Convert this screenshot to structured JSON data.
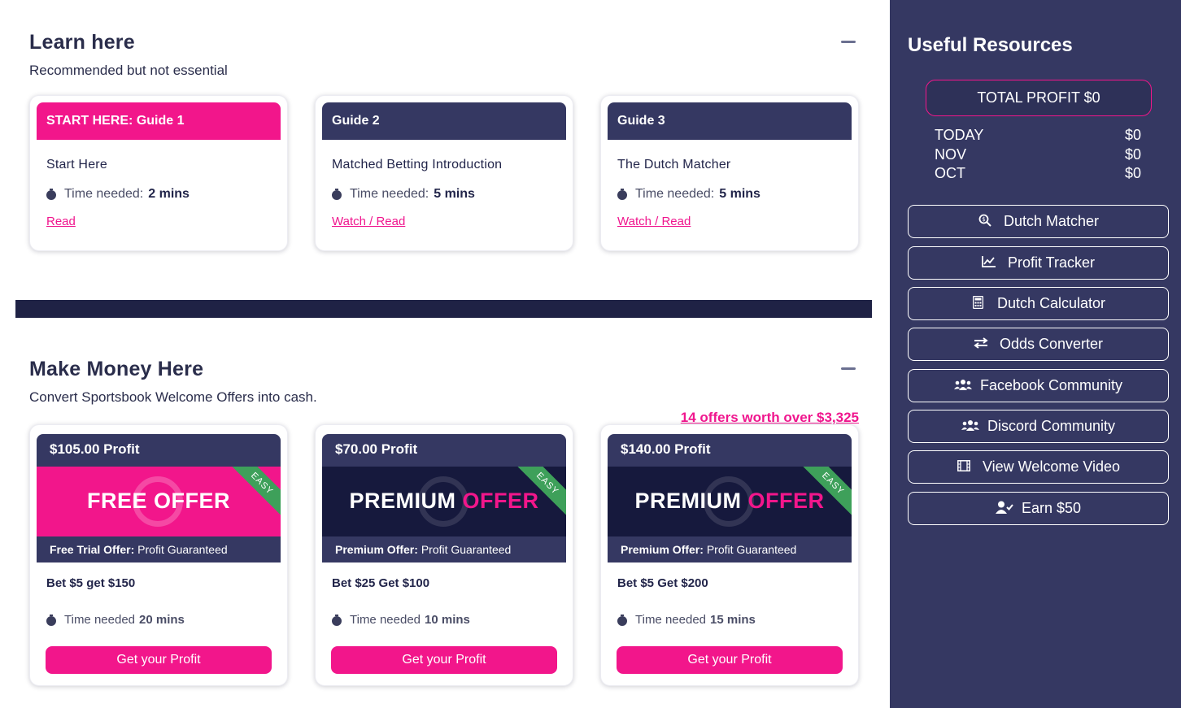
{
  "learn": {
    "title": "Learn here",
    "subtitle": "Recommended but not essential",
    "guides": [
      {
        "header": "START HERE: Guide 1",
        "title": "Start Here",
        "time_label": "Time needed:",
        "time": "2 mins",
        "link": "Read"
      },
      {
        "header": "Guide 2",
        "title": "Matched Betting Introduction",
        "time_label": "Time needed:",
        "time": "5 mins",
        "link": "Watch / Read"
      },
      {
        "header": "Guide 3",
        "title": "The Dutch Matcher",
        "time_label": "Time needed:",
        "time": "5 mins",
        "link": "Watch / Read"
      }
    ]
  },
  "money": {
    "title": "Make Money Here",
    "subtitle": "Convert Sportsbook Welcome Offers into cash.",
    "offers_link": "14 offers worth over $3,325",
    "offers": [
      {
        "profit": "$105.00 Profit",
        "banner_main": "FREE OFFER",
        "banner_accent": "",
        "ribbon": "EASY",
        "foot_bold": "Free Trial Offer:",
        "foot_text": "Profit Guaranteed",
        "bet": "Bet $5 get $150",
        "time_label": "Time needed",
        "time": "20 mins",
        "button": "Get your Profit"
      },
      {
        "profit": "$70.00 Profit",
        "banner_main": "PREMIUM ",
        "banner_accent": "OFFER",
        "ribbon": "EASY",
        "foot_bold": "Premium Offer:",
        "foot_text": "Profit Guaranteed",
        "bet": "Bet $25 Get $100",
        "time_label": "Time needed",
        "time": "10 mins",
        "button": "Get your Profit"
      },
      {
        "profit": "$140.00 Profit",
        "banner_main": "PREMIUM ",
        "banner_accent": "OFFER",
        "ribbon": "EASY",
        "foot_bold": "Premium Offer:",
        "foot_text": "Profit Guaranteed",
        "bet": "Bet $5 Get $200",
        "time_label": "Time needed",
        "time": "15 mins",
        "button": "Get your Profit"
      }
    ]
  },
  "sidebar": {
    "title": "Useful Resources",
    "total_profit": "TOTAL PROFIT $0",
    "rows": [
      {
        "label": "TODAY",
        "value": "$0"
      },
      {
        "label": "NOV",
        "value": "$0"
      },
      {
        "label": "OCT",
        "value": "$0"
      }
    ],
    "buttons": [
      {
        "label": "Dutch Matcher",
        "icon": "search-dollar-icon"
      },
      {
        "label": "Profit Tracker",
        "icon": "chart-line-icon"
      },
      {
        "label": "Dutch Calculator",
        "icon": "calculator-icon"
      },
      {
        "label": "Odds Converter",
        "icon": "exchange-arrows-icon"
      },
      {
        "label": "Facebook Community",
        "icon": "users-icon"
      },
      {
        "label": "Discord Community",
        "icon": "users-icon"
      },
      {
        "label": "View Welcome Video",
        "icon": "film-icon"
      },
      {
        "label": "Earn $50",
        "icon": "user-check-icon"
      }
    ]
  },
  "colors": {
    "accent": "#f2168b",
    "navy": "#353862",
    "divider": "#1f2245",
    "easy": "#3ea05a"
  }
}
